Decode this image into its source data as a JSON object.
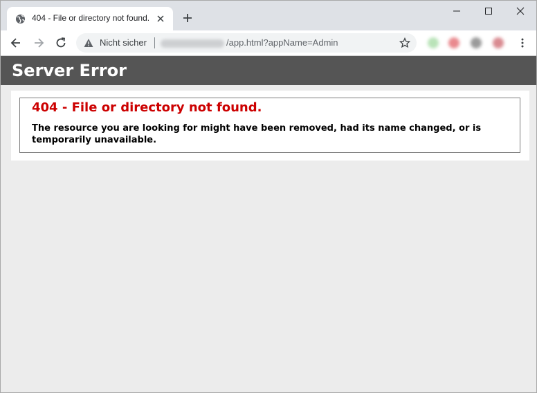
{
  "browser": {
    "tab": {
      "title": "404 - File or directory not found."
    },
    "address_bar": {
      "security_label": "Nicht sicher",
      "url_path": "/app.html?appName=Admin"
    }
  },
  "page": {
    "header": {
      "title": "Server Error"
    },
    "error": {
      "title": "404 - File or directory not found.",
      "description": "The resource you are looking for might have been removed, had its name changed, or is temporarily unavailable."
    }
  },
  "colors": {
    "header_bg": "#555555",
    "error_title": "#cc0000",
    "page_bg": "#ececec"
  },
  "icons": [
    "globe-icon",
    "close-icon",
    "plus-icon",
    "minimize-icon",
    "maximize-icon",
    "window-close-icon",
    "back-arrow-icon",
    "forward-arrow-icon",
    "reload-icon",
    "warning-icon",
    "star-icon",
    "menu-dots-icon"
  ]
}
